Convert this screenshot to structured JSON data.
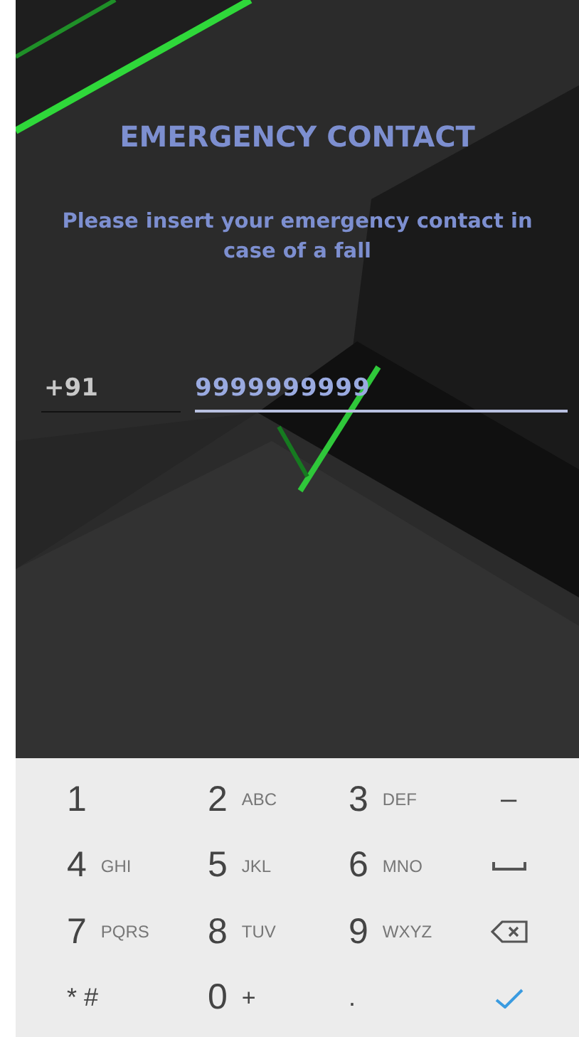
{
  "title": "EMERGENCY CONTACT",
  "message": "Please insert your emergency contact in case of a fall",
  "phone": {
    "country_code": "+91",
    "value": "9999999999"
  },
  "keypad": [
    {
      "kind": "text",
      "main": "1"
    },
    {
      "kind": "text",
      "main": "2",
      "sub": "ABC"
    },
    {
      "kind": "text",
      "main": "3",
      "sub": "DEF"
    },
    {
      "kind": "text",
      "main": "–"
    },
    {
      "kind": "text",
      "main": "4",
      "sub": "GHI"
    },
    {
      "kind": "text",
      "main": "5",
      "sub": "JKL"
    },
    {
      "kind": "text",
      "main": "6",
      "sub": "MNO"
    },
    {
      "kind": "space"
    },
    {
      "kind": "text",
      "main": "7",
      "sub": "PQRS"
    },
    {
      "kind": "text",
      "main": "8",
      "sub": "TUV"
    },
    {
      "kind": "text",
      "main": "9",
      "sub": "WXYZ"
    },
    {
      "kind": "backspace"
    },
    {
      "kind": "text",
      "main": "* #"
    },
    {
      "kind": "text",
      "main": "0",
      "sub": "+"
    },
    {
      "kind": "text",
      "main": "."
    },
    {
      "kind": "done"
    }
  ]
}
